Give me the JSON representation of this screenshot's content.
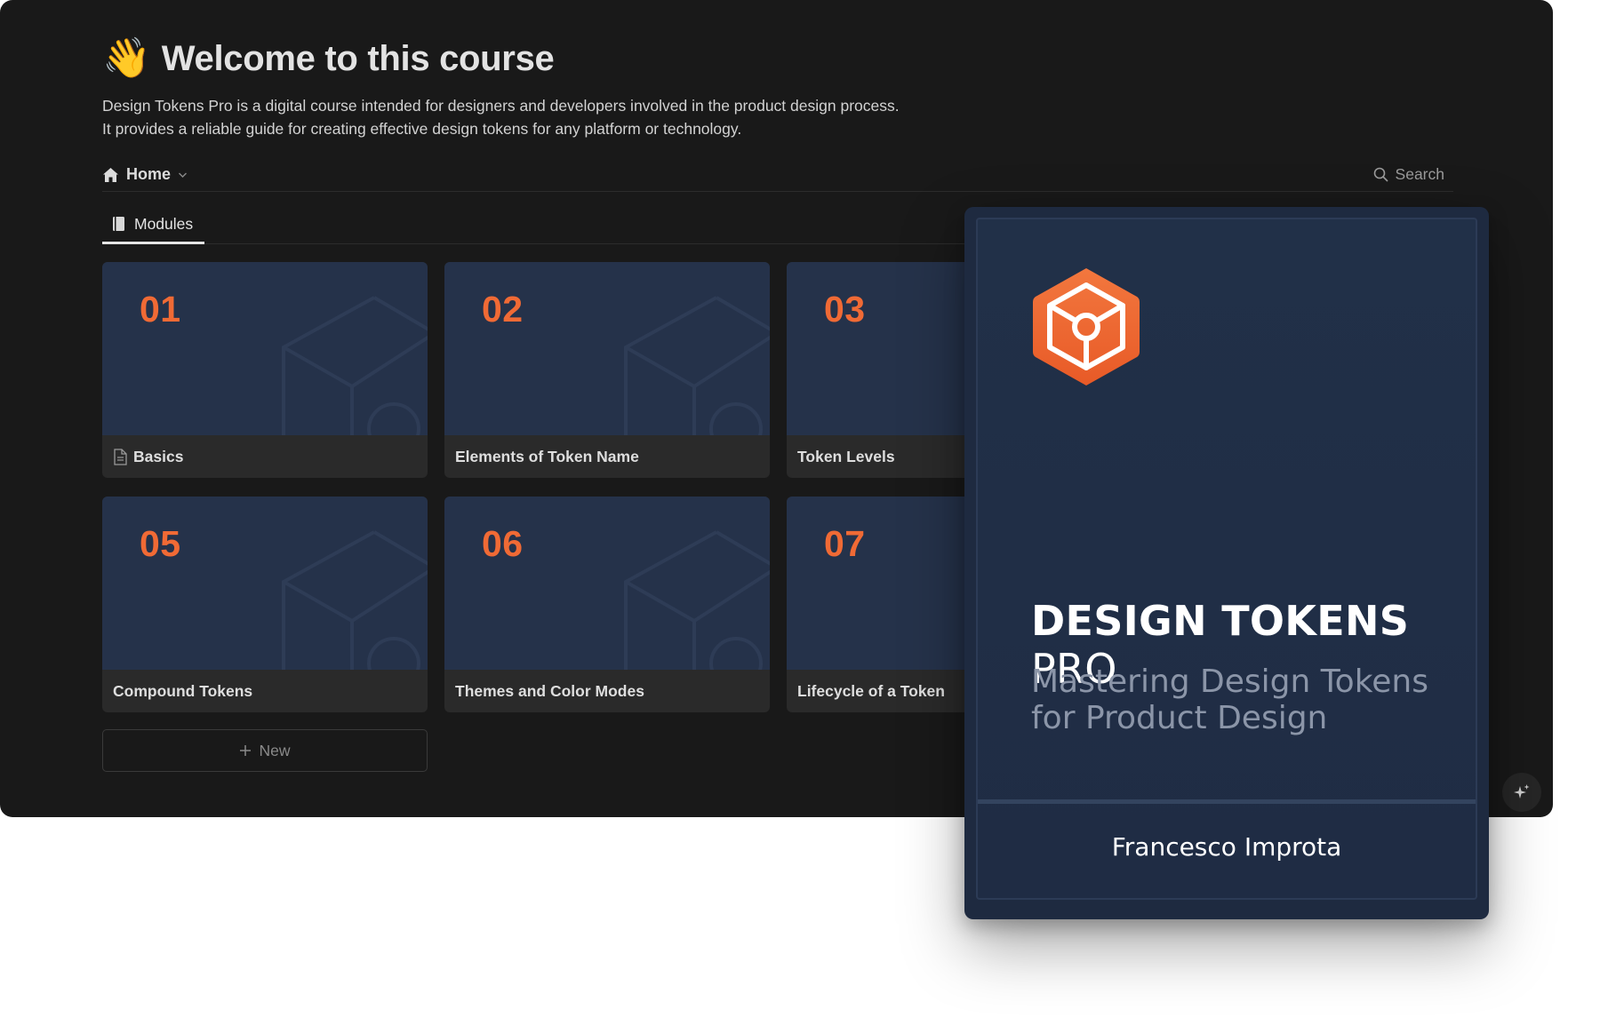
{
  "header": {
    "emoji": "👋",
    "title": "Welcome to this course",
    "description_line1": "Design Tokens Pro is a digital course intended for designers and developers involved in the product design process.",
    "description_line2": "It provides a reliable guide for creating effective design tokens for any platform or technology."
  },
  "nav": {
    "home_label": "Home",
    "search_label": "Search"
  },
  "tabs": [
    {
      "label": "Modules",
      "icon": "book-icon"
    }
  ],
  "modules": [
    {
      "number": "01",
      "title": "Basics",
      "icon": "page-icon"
    },
    {
      "number": "02",
      "title": "Elements of Token Name"
    },
    {
      "number": "03",
      "title": "Token Levels"
    },
    {
      "number": "05",
      "title": "Compound Tokens"
    },
    {
      "number": "06",
      "title": "Themes and Color Modes"
    },
    {
      "number": "07",
      "title": "Lifecycle of a Token"
    }
  ],
  "new_button": {
    "label": "New",
    "icon": "plus-icon"
  },
  "book_cover": {
    "title_bold": "DESIGN TOKENS",
    "title_light": "PRO",
    "subtitle": "Mastering Design Tokens for Product Design",
    "author": "Francesco Improta",
    "logo_icon": "hexagon-cube-logo"
  },
  "colors": {
    "background": "#191919",
    "card_cover": "#25324a",
    "accent_orange": "#f06a35",
    "book_cover": "#1e2a40"
  }
}
